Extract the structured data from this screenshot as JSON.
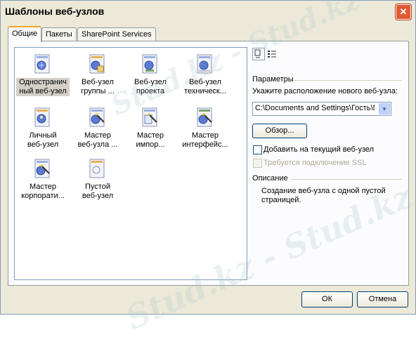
{
  "dialog": {
    "title": "Шаблоны веб-узлов",
    "close_glyph": "✕",
    "tabs": [
      {
        "label": "Общие",
        "active": true
      },
      {
        "label": "Пакеты",
        "active": false
      },
      {
        "label": "SharePoint Services",
        "active": false
      }
    ]
  },
  "templates": [
    {
      "label_line1": "Одностранич",
      "label_line2": "ный веб-узел",
      "icon": "single-page-site-icon",
      "selected": true
    },
    {
      "label_line1": "Веб-узел",
      "label_line2": "группы ...",
      "icon": "team-site-icon",
      "selected": false
    },
    {
      "label_line1": "Веб-узел",
      "label_line2": "проекта",
      "icon": "project-site-icon",
      "selected": false
    },
    {
      "label_line1": "Веб-узел",
      "label_line2": "техническ...",
      "icon": "support-site-icon",
      "selected": false
    },
    {
      "label_line1": "Личный",
      "label_line2": "веб-узел",
      "icon": "personal-site-icon",
      "selected": false
    },
    {
      "label_line1": "Мастер",
      "label_line2": "веб-узла ...",
      "icon": "wizard-site-icon",
      "selected": false
    },
    {
      "label_line1": "Мастер",
      "label_line2": "импор...",
      "icon": "import-wizard-icon",
      "selected": false
    },
    {
      "label_line1": "Мастер",
      "label_line2": "интерфейс...",
      "icon": "interface-wizard-icon",
      "selected": false
    },
    {
      "label_line1": "Мастер",
      "label_line2": "корпорати...",
      "icon": "corporate-wizard-icon",
      "selected": false
    },
    {
      "label_line1": "Пустой",
      "label_line2": "веб-узел",
      "icon": "empty-site-icon",
      "selected": false
    }
  ],
  "parameters": {
    "heading": "Параметры",
    "location_label": "Укажите расположение нового веб-узла:",
    "location_value": "C:\\Documents and Settings\\Гость\\Мои",
    "browse_button": "Обзор...",
    "add_to_current_label": "Добавить на текущий веб-узел",
    "add_to_current_checked": false,
    "ssl_label": "Требуется подключение SSL",
    "ssl_checked": false,
    "ssl_enabled": false
  },
  "description": {
    "heading": "Описание",
    "text_line1": "Создание веб-узла с одной пустой",
    "text_line2": "страницей."
  },
  "footer": {
    "ok_button": "ОК",
    "cancel_button": "Отмена"
  },
  "watermark_text": "Stud.kz - Stud.kz",
  "colors": {
    "accent_tab": "#f3a72b",
    "close_button": "#e05a33",
    "dialog_bg": "#ece9d8"
  }
}
